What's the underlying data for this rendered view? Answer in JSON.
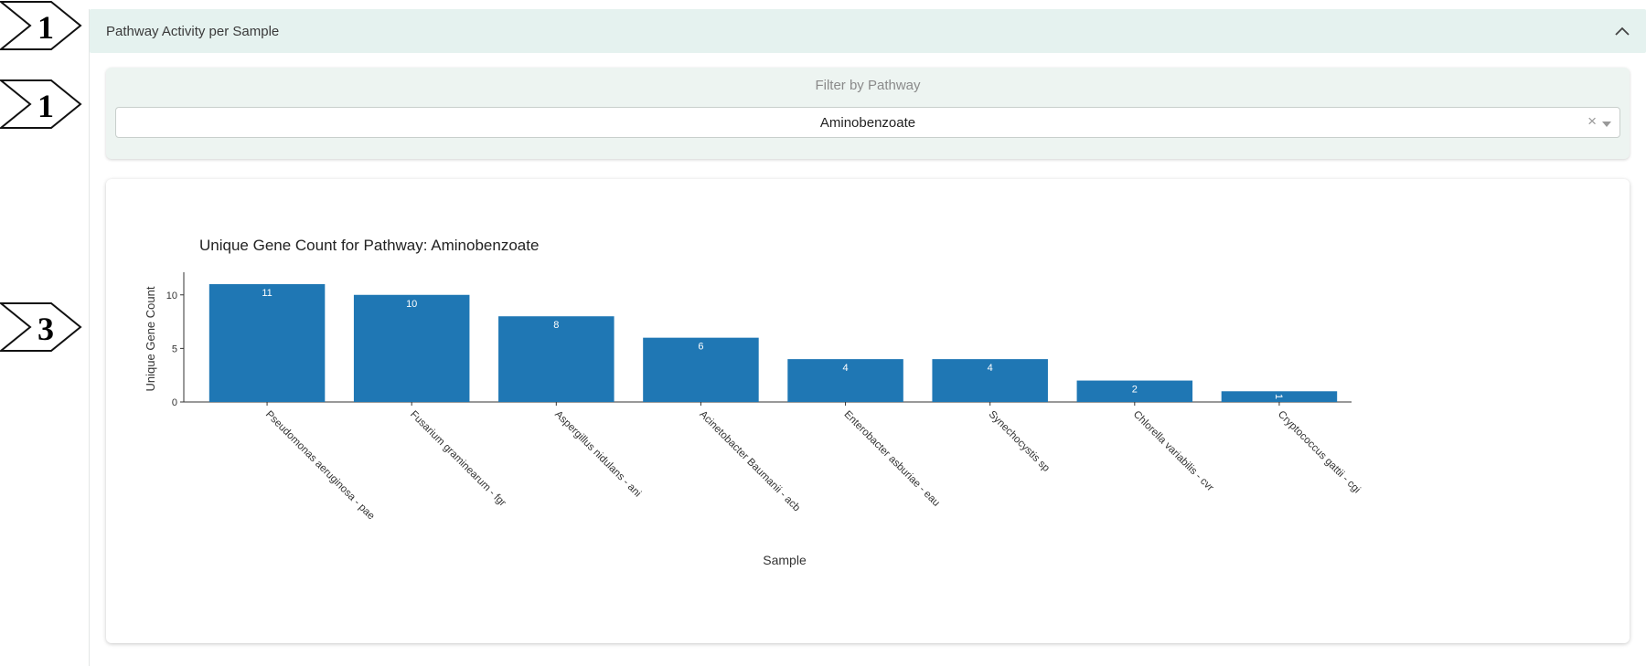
{
  "markers": [
    "1",
    "1",
    "3"
  ],
  "panel": {
    "title": "Pathway Activity per Sample",
    "collapse_icon": "chevron-up-icon"
  },
  "filter": {
    "label": "Filter by Pathway",
    "value": "Aminobenzoate",
    "clear_symbol": "×",
    "dropdown_icon": "caret-down-icon"
  },
  "colors": {
    "bar": "#1f77b4",
    "header_bg": "#e5f2ef",
    "filter_bg": "#edf4f1"
  },
  "chart_data": {
    "type": "bar",
    "title": "Unique Gene Count for Pathway: Aminobenzoate",
    "xlabel": "Sample",
    "ylabel": "Unique Gene Count",
    "categories": [
      "Pseudomonas aeruginosa - pae",
      "Fusarium graminearum - fgr",
      "Aspergillus nidulans - ani",
      "Acinetobacter Baumanii - acb",
      "Enterobacter asburiae - eau",
      "Synechocystis sp",
      "Chlorella variabilis - cvr",
      "Cryptococcus gattii - cgi"
    ],
    "values": [
      11,
      10,
      8,
      6,
      4,
      4,
      2,
      1
    ],
    "data_labels": [
      "11",
      "10",
      "8",
      "6",
      "4",
      "4",
      "2",
      "1"
    ],
    "yticks": [
      "0",
      "5",
      "10"
    ],
    "ytick_values": [
      0,
      5,
      10
    ],
    "ylim": [
      0,
      11.6
    ],
    "grid": false,
    "legend": "none"
  }
}
